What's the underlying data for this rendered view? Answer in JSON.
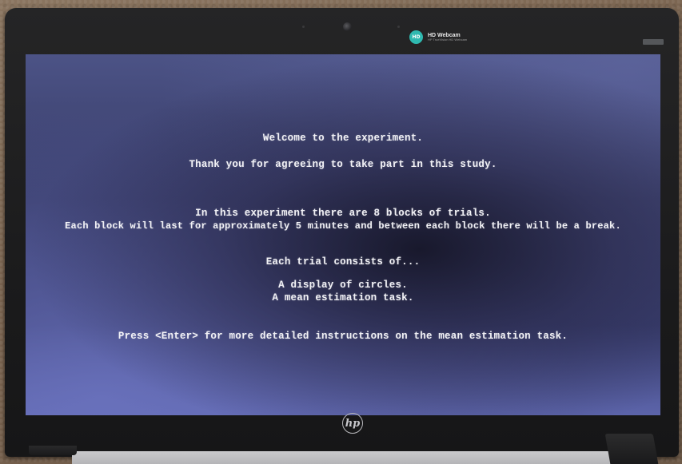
{
  "device": {
    "brand_logo": "hp",
    "webcam_badge": {
      "logo_text": "HD",
      "title": "HD Webcam",
      "subtitle": "HP TrueVision HD Webcam"
    }
  },
  "screen": {
    "background_color": "#3a3f72",
    "text_color": "#f2f2f6",
    "lines": {
      "welcome": "Welcome to the experiment.",
      "thanks": "Thank you for agreeing to take part in this study.",
      "blocks": "In this experiment there are 8 blocks of trials.",
      "duration": "Each block will last for approximately 5 minutes and between each block there will be a break.",
      "trial_intro": "Each trial consists of...",
      "trial_item_1": "A display of circles.",
      "trial_item_2": "A mean estimation task.",
      "prompt": "Press <Enter> for more detailed instructions on the mean estimation task."
    }
  },
  "icons": [
    "webcam-icon",
    "hp-logo-icon",
    "webcam-badge-icon"
  ]
}
